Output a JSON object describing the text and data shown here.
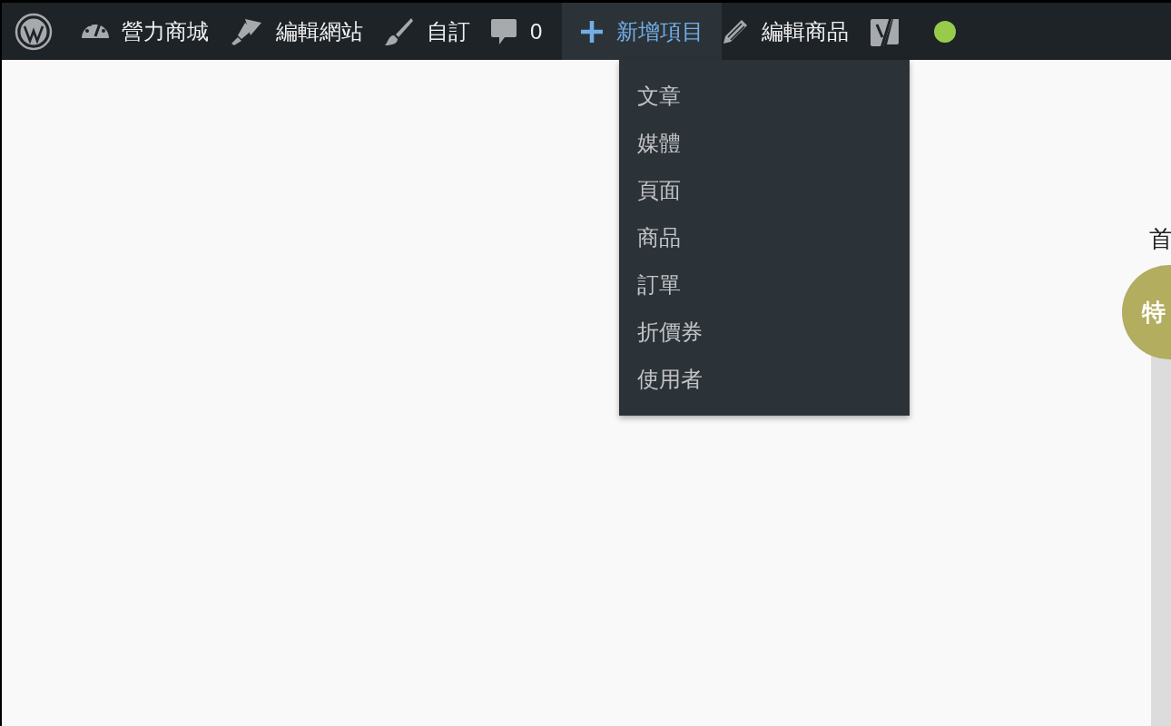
{
  "admin_bar": {
    "items": [
      {
        "kind": "logo"
      },
      {
        "kind": "dashboard",
        "label": "營力商城",
        "selected": false
      },
      {
        "kind": "brush",
        "label": "編輯網站",
        "selected": false
      },
      {
        "kind": "paint",
        "label": "自訂",
        "selected": false
      },
      {
        "kind": "comments",
        "label": "0",
        "selected": false
      },
      {
        "kind": "plus",
        "label": "新增項目",
        "selected": true
      },
      {
        "kind": "pencil",
        "label": "編輯商品",
        "selected": false
      },
      {
        "kind": "yoast",
        "selected": false
      },
      {
        "kind": "status",
        "color": "#97cc4b"
      }
    ]
  },
  "new_menu": {
    "items": [
      "文章",
      "媒體",
      "頁面",
      "商品",
      "訂單",
      "折價券",
      "使用者"
    ]
  },
  "page": {
    "breadcrumb": "首",
    "badge": "特"
  }
}
